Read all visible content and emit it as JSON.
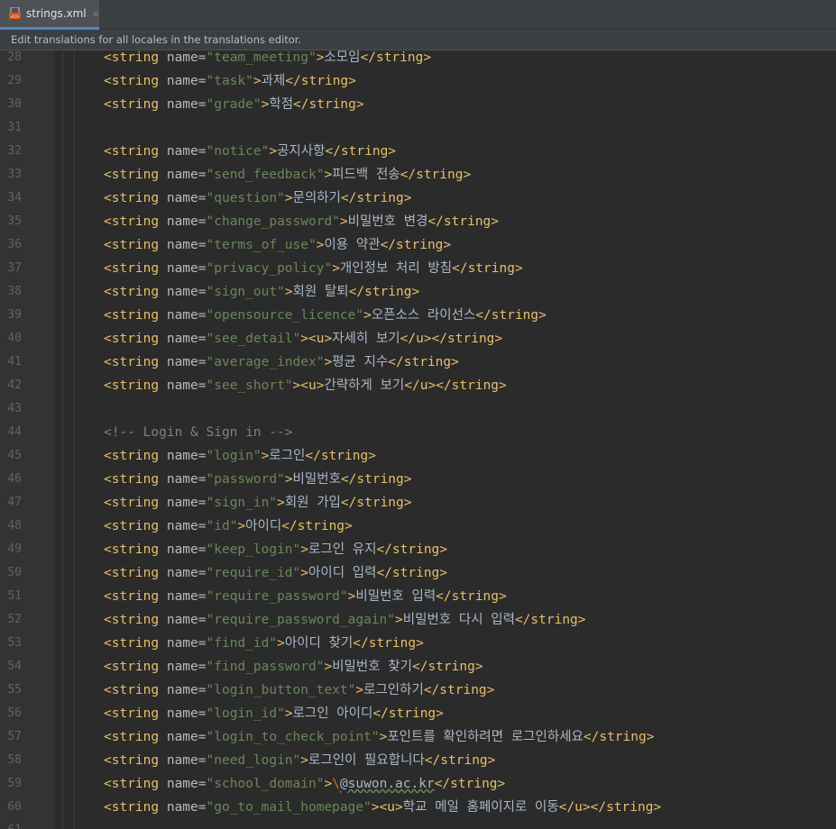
{
  "tab": {
    "filename": "strings.xml",
    "icon": "xml-file-icon",
    "close": "×"
  },
  "banner": {
    "text": "Edit translations for all locales in the translations editor."
  },
  "colors": {
    "tag": "#e8bf6a",
    "attr": "#bababa",
    "value": "#6a8759",
    "text": "#a9b7c6",
    "comment": "#808080",
    "background": "#2b2b2b"
  },
  "lines": [
    {
      "n": "28",
      "kind": "string",
      "name": "team_meeting",
      "text": "소모임"
    },
    {
      "n": "29",
      "kind": "string",
      "name": "task",
      "text": "과제"
    },
    {
      "n": "30",
      "kind": "string",
      "name": "grade",
      "text": "학점"
    },
    {
      "n": "31",
      "kind": "blank"
    },
    {
      "n": "32",
      "kind": "string",
      "name": "notice",
      "text": "공지사항"
    },
    {
      "n": "33",
      "kind": "string",
      "name": "send_feedback",
      "text": "피드백 전송"
    },
    {
      "n": "34",
      "kind": "string",
      "name": "question",
      "text": "문의하기"
    },
    {
      "n": "35",
      "kind": "string",
      "name": "change_password",
      "text": "비밀번호 변경"
    },
    {
      "n": "36",
      "kind": "string",
      "name": "terms_of_use",
      "text": "이용 약관"
    },
    {
      "n": "37",
      "kind": "string",
      "name": "privacy_policy",
      "text": "개인정보 처리 방침"
    },
    {
      "n": "38",
      "kind": "string",
      "name": "sign_out",
      "text": "회원 탈퇴"
    },
    {
      "n": "39",
      "kind": "string",
      "name": "opensource_licence",
      "text": "오픈소스 라이선스"
    },
    {
      "n": "40",
      "kind": "string_u",
      "name": "see_detail",
      "text": "자세히 보기"
    },
    {
      "n": "41",
      "kind": "string",
      "name": "average_index",
      "text": "평균 지수"
    },
    {
      "n": "42",
      "kind": "string_u",
      "name": "see_short",
      "text": "간략하게 보기"
    },
    {
      "n": "43",
      "kind": "blank"
    },
    {
      "n": "44",
      "kind": "comment",
      "text": "<!-- Login & Sign in -->"
    },
    {
      "n": "45",
      "kind": "string",
      "name": "login",
      "text": "로그인"
    },
    {
      "n": "46",
      "kind": "string",
      "name": "password",
      "text": "비밀번호"
    },
    {
      "n": "47",
      "kind": "string",
      "name": "sign_in",
      "text": "회원 가입"
    },
    {
      "n": "48",
      "kind": "string",
      "name": "id",
      "text": "아이디"
    },
    {
      "n": "49",
      "kind": "string",
      "name": "keep_login",
      "text": "로그인 유지"
    },
    {
      "n": "50",
      "kind": "string",
      "name": "require_id",
      "text": "아이디 입력"
    },
    {
      "n": "51",
      "kind": "string",
      "name": "require_password",
      "text": "비밀번호 입력"
    },
    {
      "n": "52",
      "kind": "string",
      "name": "require_password_again",
      "text": "비밀번호 다시 입력"
    },
    {
      "n": "53",
      "kind": "string",
      "name": "find_id",
      "text": "아이디 찾기"
    },
    {
      "n": "54",
      "kind": "string",
      "name": "find_password",
      "text": "비밀번호 찾기"
    },
    {
      "n": "55",
      "kind": "string",
      "name": "login_button_text",
      "text": "로그인하기"
    },
    {
      "n": "56",
      "kind": "string",
      "name": "login_id",
      "text": "로그인 아이디"
    },
    {
      "n": "57",
      "kind": "string",
      "name": "login_to_check_point",
      "text": "포인트를 확인하려면 로그인하세요"
    },
    {
      "n": "58",
      "kind": "string",
      "name": "need_login",
      "text": "로그인이 필요합니다"
    },
    {
      "n": "59",
      "kind": "string_esc",
      "name": "school_domain",
      "esc": "\\",
      "text": "@suwon.ac.kr"
    },
    {
      "n": "60",
      "kind": "string_u",
      "name": "go_to_mail_homepage",
      "text": "학교 메일 홈페이지로 이동"
    },
    {
      "n": "61",
      "kind": "blank"
    }
  ]
}
